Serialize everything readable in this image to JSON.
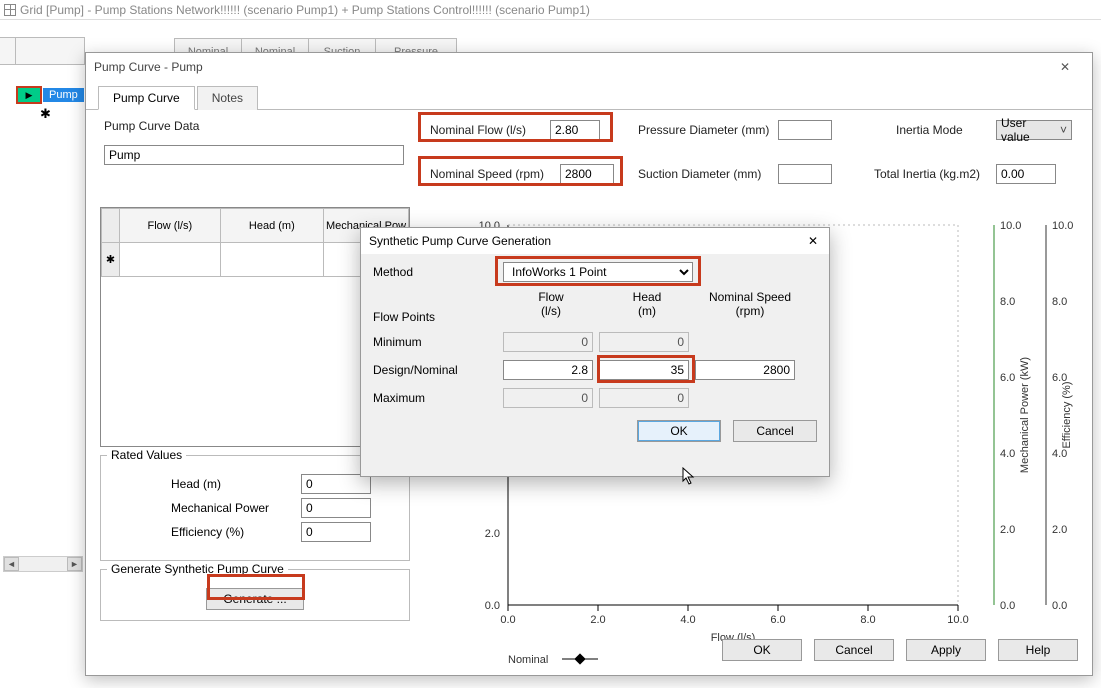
{
  "main_window": {
    "title": "Grid [Pump] - Pump Stations Network!!!!!! (scenario Pump1)  + Pump Stations Control!!!!!! (scenario Pump1)"
  },
  "bg_headers": [
    "Nominal",
    "Nominal",
    "Suction",
    "Pressure"
  ],
  "left_tag": "Pump",
  "dialog": {
    "title": "Pump Curve - Pump",
    "tabs": {
      "active": "Pump Curve",
      "inactive": "Notes"
    },
    "section_label": "Pump Curve Data",
    "name_value": "Pump",
    "nominal_flow": {
      "label": "Nominal Flow (l/s)",
      "value": "2.80"
    },
    "nominal_speed": {
      "label": "Nominal Speed (rpm)",
      "value": "2800"
    },
    "pressure_diameter": {
      "label": "Pressure Diameter (mm)",
      "value": ""
    },
    "suction_diameter": {
      "label": "Suction Diameter (mm)",
      "value": ""
    },
    "inertia_mode": {
      "label": "Inertia Mode",
      "value": "User value"
    },
    "total_inertia": {
      "label": "Total Inertia (kg.m2)",
      "value": "0.00"
    },
    "grid_headers": [
      "Flow (l/s)",
      "Head (m)",
      "Mechanical Pow"
    ],
    "rated": {
      "title": "Rated Values",
      "head": {
        "label": "Head (m)",
        "value": "0"
      },
      "power": {
        "label": "Mechanical Power",
        "value": "0"
      },
      "eff": {
        "label": "Efficiency (%)",
        "value": "0"
      }
    },
    "generate_group": {
      "title": "Generate Synthetic Pump Curve",
      "button": "Generate ..."
    },
    "footer": {
      "ok": "OK",
      "cancel": "Cancel",
      "apply": "Apply",
      "help": "Help"
    }
  },
  "modal": {
    "title": "Synthetic Pump Curve Generation",
    "method_label": "Method",
    "method_value": "InfoWorks 1 Point",
    "flow_points_label": "Flow Points",
    "col_headers": {
      "flow": "Flow",
      "flow_unit": "(l/s)",
      "head": "Head",
      "head_unit": "(m)",
      "speed": "Nominal Speed",
      "speed_unit": "(rpm)"
    },
    "rows": {
      "min": {
        "label": "Minimum",
        "flow": "0",
        "head": "0",
        "speed": ""
      },
      "design": {
        "label": "Design/Nominal",
        "flow": "2.8",
        "head": "35",
        "speed": "2800"
      },
      "max": {
        "label": "Maximum",
        "flow": "0",
        "head": "0",
        "speed": ""
      }
    },
    "ok": "OK",
    "cancel": "Cancel"
  },
  "chart_data": {
    "type": "line",
    "title": "",
    "xlabel": "Flow (l/s)",
    "x_ticks": [
      "0.0",
      "2.0",
      "4.0",
      "6.0",
      "8.0",
      "10.0"
    ],
    "left_axis": {
      "label": "",
      "ticks": [
        "0.0",
        "2.0",
        "10.0"
      ],
      "range": [
        0,
        10
      ]
    },
    "right_axis_1": {
      "label": "Mechanical Power (kW)",
      "color": "#2a8a2a",
      "ticks": [
        "0.0",
        "2.0",
        "4.0",
        "6.0",
        "8.0",
        "10.0"
      ],
      "range": [
        0,
        10
      ]
    },
    "right_axis_2": {
      "label": "Efficiency (%)",
      "color": "#333",
      "ticks": [
        "0.0",
        "2.0",
        "4.0",
        "6.0",
        "8.0",
        "10.0"
      ],
      "range": [
        0,
        10
      ]
    },
    "series": [],
    "legend": "Nominal"
  }
}
